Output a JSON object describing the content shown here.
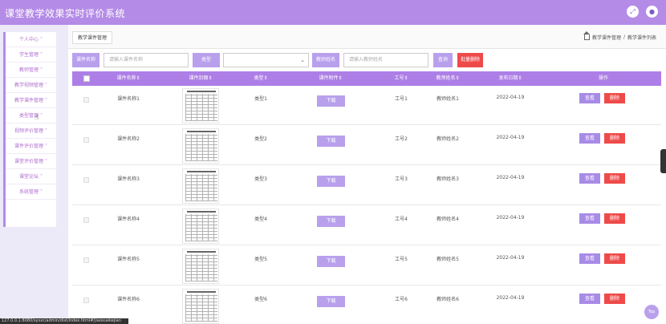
{
  "app": {
    "title": "课堂教学效果实时评价系统"
  },
  "topbar": {
    "icons": [
      "expand-icon",
      "user-icon"
    ]
  },
  "sidebar": {
    "items": [
      {
        "label": "个人中心"
      },
      {
        "label": "学生管理"
      },
      {
        "label": "教师管理"
      },
      {
        "label": "教学视频管理"
      },
      {
        "label": "教学课件管理"
      },
      {
        "label": "类型管理"
      },
      {
        "label": "视频评价管理"
      },
      {
        "label": "课件评价管理"
      },
      {
        "label": "课堂评价管理"
      },
      {
        "label": "课堂论坛"
      },
      {
        "label": "系统管理"
      }
    ],
    "chevron": "˅"
  },
  "tabs": {
    "active": "教学课件管理"
  },
  "breadcrumb": {
    "items": [
      "教学课件管理",
      "教学课件列表"
    ],
    "sep": "/"
  },
  "search": {
    "name_label": "课件名称",
    "name_placeholder": "请输入课件名称",
    "type_label": "类型",
    "type_value": "",
    "teacher_label": "教师姓名",
    "teacher_placeholder": "请输入教师姓名",
    "search_button": "查询",
    "batch_delete_button": "批量删除"
  },
  "table": {
    "columns": [
      "课件名称",
      "课件封面",
      "类型",
      "课件附件",
      "工号",
      "教师姓名",
      "发布日期",
      "操作"
    ],
    "sort_mark": "⇕",
    "download_label": "下载",
    "view_label": "查看",
    "delete_label": "删除",
    "rows": [
      {
        "name": "课件名称1",
        "type": "类型1",
        "job_no": "工号1",
        "teacher": "教师姓名1",
        "date": "2022-04-19"
      },
      {
        "name": "课件名称2",
        "type": "类型2",
        "job_no": "工号2",
        "teacher": "教师姓名2",
        "date": "2022-04-19"
      },
      {
        "name": "课件名称3",
        "type": "类型3",
        "job_no": "工号3",
        "teacher": "教师姓名3",
        "date": "2022-04-19"
      },
      {
        "name": "课件名称4",
        "type": "类型4",
        "job_no": "工号4",
        "teacher": "教师姓名4",
        "date": "2022-04-19"
      },
      {
        "name": "课件名称5",
        "type": "类型5",
        "job_no": "工号5",
        "teacher": "教师姓名5",
        "date": "2022-04-19"
      },
      {
        "name": "课件名称6",
        "type": "类型6",
        "job_no": "工号6",
        "teacher": "教师姓名6",
        "date": "2022-04-19"
      }
    ]
  },
  "top_button": "Top",
  "status_url": "127.0.0.1:8080/sysxc/admin/dist/index.html#/jiaoxuekejian",
  "colors": {
    "accent": "#b48be6",
    "danger": "#ee4a4a",
    "sidebar_text": "#b070d0"
  }
}
